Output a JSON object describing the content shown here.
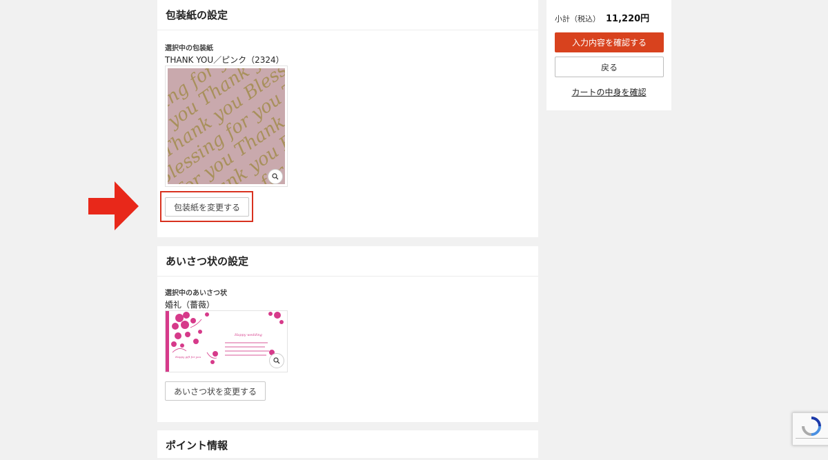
{
  "wrapping": {
    "title": "包装紙の設定",
    "selected_label": "選択中の包装紙",
    "selected_name": "THANK YOU／ピンク（2324）",
    "change_button": "包装紙を変更する",
    "pattern_words": [
      "Blessing",
      "for you",
      "Thank you"
    ],
    "background_color": "#c9a9ad",
    "script_color": "#a8905c"
  },
  "greeting": {
    "title": "あいさつ状の設定",
    "selected_label": "選択中のあいさつ状",
    "selected_name": "婚礼（薔薇）",
    "change_button": "あいさつ状を変更する",
    "card_heading": "Happy wedding",
    "card_side_text": "Happy gift for you",
    "accent_color": "#d63a8a"
  },
  "points": {
    "title": "ポイント情報"
  },
  "sidebar": {
    "subtotal_label": "小計（税込）",
    "subtotal_value": "11,220円",
    "confirm_button": "入力内容を確認する",
    "back_button": "戻る",
    "cart_link": "カートの中身を確認"
  },
  "annotation": {
    "arrow_color": "#e8281a",
    "highlight_color": "#d8311f"
  }
}
